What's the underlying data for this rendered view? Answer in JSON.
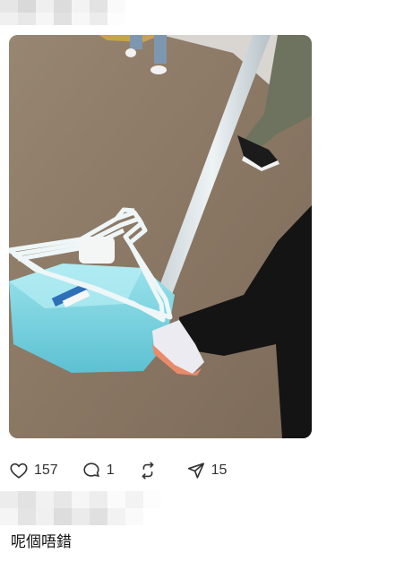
{
  "post": {
    "image_alt": "photo",
    "actions": {
      "like_count": "157",
      "reply_count": "1",
      "repost_count": "",
      "share_count": "15"
    }
  },
  "reply": {
    "text": "呢個唔錯"
  },
  "icons": {
    "like": "heart-icon",
    "reply": "comment-bubble-icon",
    "repost": "repost-arrows-icon",
    "share": "send-plane-icon"
  },
  "colors": {
    "icon_stroke": "#333333",
    "dustpan": "#7fd3e0",
    "hangers": "#eef6f7",
    "floor": "#8d7a68"
  }
}
